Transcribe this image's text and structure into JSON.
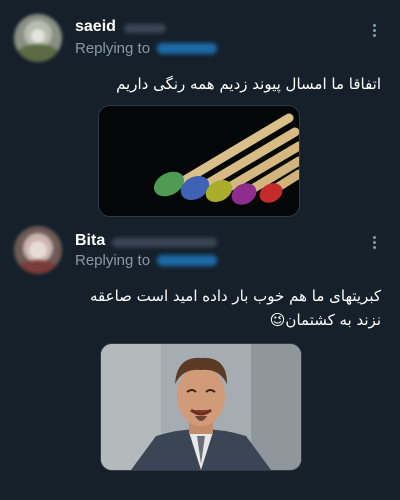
{
  "tweets": [
    {
      "username": "saeid",
      "replying_label": "Replying to",
      "text": "اتفاقا ما امسال پیوند زدیم همه رنگی داریم",
      "media_icon": "matchsticks-image"
    },
    {
      "username": "Bita",
      "replying_label": "Replying to",
      "text": "کبریتهای ما هم خوب بار داده امید است صاعقه نزند به کشتمان😉",
      "media_icon": "laughing-man-image"
    }
  ],
  "colors": {
    "background": "#15202b",
    "secondary_text": "#8899a6",
    "mention": "#1d9bf0"
  }
}
